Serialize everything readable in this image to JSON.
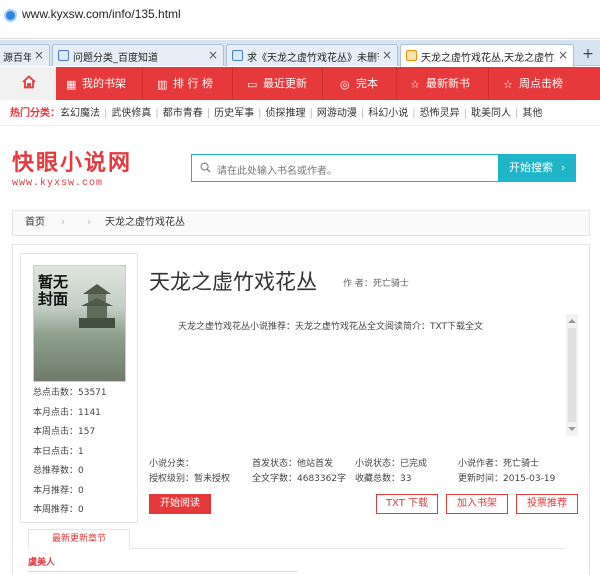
{
  "browser": {
    "url": "www.kyxsw.com/info/135.html",
    "tabs": [
      {
        "label": "源百年起",
        "active": false
      },
      {
        "label": "问题分类_百度知道",
        "active": false
      },
      {
        "label": "求《天龙之虚竹戏花丛》未删节",
        "active": false
      },
      {
        "label": "天龙之虚竹戏花丛,天龙之虚竹戏",
        "active": true
      }
    ],
    "new_tab": "+"
  },
  "nav": {
    "items": [
      {
        "label": "我的书架",
        "icon": "bookshelf-icon"
      },
      {
        "label": "排 行 榜",
        "icon": "ranking-icon"
      },
      {
        "label": "最近更新",
        "icon": "update-icon"
      },
      {
        "label": "完本",
        "icon": "finished-icon"
      },
      {
        "label": "最新新书",
        "icon": "star-icon"
      },
      {
        "label": "周点击榜",
        "icon": "star-icon"
      }
    ],
    "home_icon": "home-icon"
  },
  "categories": {
    "label": "热门分类：",
    "items": [
      "玄幻魔法",
      "武侠修真",
      "都市青春",
      "历史军事",
      "侦探推理",
      "网游动漫",
      "科幻小说",
      "恐怖灵异",
      "耽美同人",
      "其他"
    ]
  },
  "logo": {
    "text": "快眼小说网",
    "domain": "www.kyxsw.com"
  },
  "search": {
    "placeholder": "请在此处输入书名或作者。",
    "button": "开始搜索"
  },
  "breadcrumb": {
    "home": "首页",
    "current": "天龙之虚竹戏花丛"
  },
  "book": {
    "cover_text": "暂无封面",
    "title": "天龙之虚竹戏花丛",
    "author_label": "作 者：死亡骑士",
    "description": "天龙之虚竹戏花丛小说推荐：天龙之虚竹戏花丛全文阅读简介：TXT下载全文",
    "stats": [
      "总点击数：53571",
      "本月点击：1141",
      "本周点击：157",
      "本日点击：1",
      "总推荐数：0",
      "本月推荐：0",
      "本周推荐：0"
    ],
    "meta": {
      "category": "小说分类：",
      "license": "授权级别：暂未授权",
      "first_publish": "首发状态：他站首发",
      "word_count": "全文字数：4683362字",
      "status": "小说状态：已完成",
      "favorites": "收藏总数：33",
      "author": "小说作者：死亡骑士",
      "update_time": "更新时间：2015-03-19"
    }
  },
  "actions": {
    "read": "开始阅读",
    "txt": "TXT 下载",
    "shelf": "加入书架",
    "vote": "投票推荐"
  },
  "latest": {
    "tab": "最新更新章节",
    "chapter": "虞美人"
  },
  "colors": {
    "brand_red": "#e6393c",
    "search_teal": "#1fb5c9"
  }
}
